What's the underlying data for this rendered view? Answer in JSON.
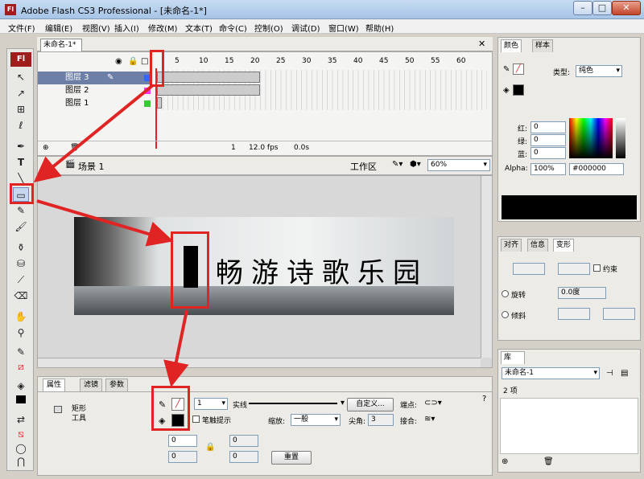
{
  "window": {
    "title": "Adobe Flash CS3 Professional - [未命名-1*]",
    "logo": "Fl"
  },
  "menu": [
    "文件(F)",
    "编辑(E)",
    "视图(V)",
    "插入(I)",
    "修改(M)",
    "文本(T)",
    "命令(C)",
    "控制(O)",
    "调试(D)",
    "窗口(W)",
    "帮助(H)"
  ],
  "document": {
    "tab": "未命名-1*"
  },
  "timeline": {
    "ruler": [
      "5",
      "10",
      "15",
      "20",
      "25",
      "30",
      "35",
      "40",
      "45",
      "50",
      "55",
      "60"
    ],
    "layers": [
      {
        "name": "图层 3",
        "color": "#3366ff",
        "selected": true
      },
      {
        "name": "图层 2",
        "color": "#ff33ff"
      },
      {
        "name": "图层 1",
        "color": "#33cc33"
      }
    ],
    "status": {
      "frame": "1",
      "fps": "12.0 fps",
      "time": "0.0s"
    }
  },
  "stage": {
    "scene": "场景 1",
    "workspace": "工作区",
    "zoom": "60%"
  },
  "banner": {
    "text": "畅游诗歌乐园"
  },
  "properties": {
    "tabs": [
      "属性",
      "滤镜",
      "参数"
    ],
    "tool_name_1": "矩形",
    "tool_name_2": "工具",
    "stroke_height": "1",
    "stroke_style": "实线",
    "custom_btn": "自定义...",
    "cap_label": "端点:",
    "join_label": "接合:",
    "hinting_label": "笔触提示",
    "scale_label": "缩放:",
    "scale_value": "一般",
    "miter_label": "尖角:",
    "miter_value": "3",
    "corner_values": [
      "0",
      "0",
      "0",
      "0"
    ],
    "reset_btn": "重置"
  },
  "color_panel": {
    "tabs": [
      "颜色",
      "样本"
    ],
    "type_label": "类型:",
    "type_value": "纯色",
    "red_label": "红:",
    "red": "0",
    "green_label": "绿:",
    "green": "0",
    "blue_label": "蓝:",
    "blue": "0",
    "alpha_label": "Alpha:",
    "alpha": "100%",
    "hex": "#000000"
  },
  "transform_panel": {
    "tabs": [
      "对齐",
      "信息",
      "变形"
    ],
    "constrain": "约束",
    "rotate": "旋转",
    "rotate_value": "0.0度",
    "skew": "倾斜"
  },
  "library_panel": {
    "tab": "库",
    "doc": "未命名-1",
    "count": "2 项"
  },
  "colors": {
    "accent_red": "#e02424",
    "flash_red": "#a31c1c"
  }
}
